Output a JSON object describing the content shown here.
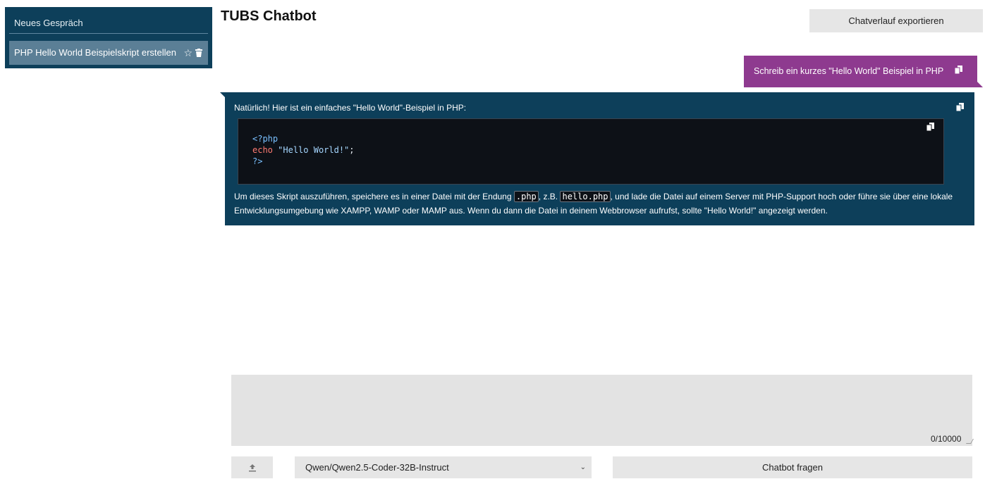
{
  "sidebar": {
    "new_chat_label": "Neues Gespräch",
    "conversations": [
      {
        "title": "PHP Hello World Beispielskript erstellen"
      }
    ]
  },
  "header": {
    "title": "TUBS Chatbot",
    "export_label": "Chatverlauf exportieren"
  },
  "messages": {
    "user": "Schreib ein kurzes \"Hello World\" Beispiel in PHP",
    "bot": {
      "intro": "Natürlich! Hier ist ein einfaches \"Hello World\"-Beispiel in PHP:",
      "code": {
        "line1": "<?php",
        "line2_kw": "echo",
        "line2_str": "\"Hello World!\"",
        "line2_end": ";",
        "line3": "?>"
      },
      "outro_part1": "Um dieses Skript auszuführen, speichere es in einer Datei mit der Endung ",
      "inline1": ".php",
      "outro_part2": ", z.B. ",
      "inline2": "hello.php",
      "outro_part3": ", und lade die Datei auf einem Server mit PHP-Support hoch oder führe sie über eine lokale Entwicklungsumgebung wie XAMPP, WAMP oder MAMP aus. Wenn du dann die Datei in deinem Webbrowser aufrufst, sollte \"Hello World!\" angezeigt werden."
    }
  },
  "input": {
    "char_count": "0/10000",
    "model": "Qwen/Qwen2.5-Coder-32B-Instruct",
    "ask_label": "Chatbot fragen"
  },
  "colors": {
    "sidebar_bg": "#0d3f5a",
    "user_bubble": "#8e3a8f",
    "bot_bubble": "#0d3f5a",
    "code_bg": "#0d1117"
  },
  "icons": {
    "star": "star-outline-icon",
    "trash": "trash-icon",
    "copy": "copy-icon",
    "upload": "upload-icon",
    "chevron": "chevron-down-icon"
  }
}
